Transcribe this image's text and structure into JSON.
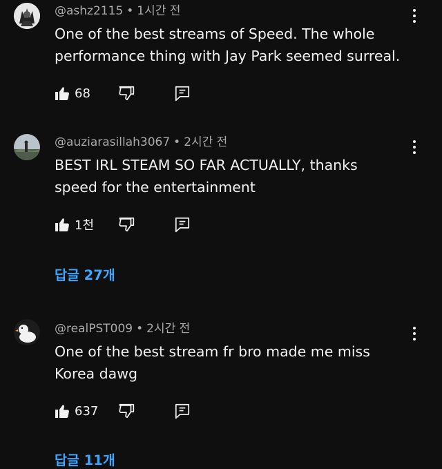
{
  "comments": [
    {
      "handle": "@ashz2115",
      "separator": "•",
      "time": "1시간 전",
      "lines": [
        "One of the best streams of Speed. The whole",
        "performance thing with Jay Park seemed surreal."
      ],
      "likes": "68",
      "replies": null
    },
    {
      "handle": "@auziarasillah3067",
      "separator": "•",
      "time": "2시간 전",
      "lines": [
        "BEST IRL STEAM SO FAR ACTUALLY, thanks",
        "speed for the entertainment"
      ],
      "likes": "1천",
      "replies": "답글 27개"
    },
    {
      "handle": "@realPST009",
      "separator": "•",
      "time": "2시간 전",
      "lines": [
        "One of the best stream fr bro made me miss",
        "Korea dawg"
      ],
      "likes": "637",
      "replies": "답글 11개"
    }
  ],
  "icons": {
    "like": "thumbs-up-icon",
    "dislike": "thumbs-down-icon",
    "reply": "reply-comment-icon",
    "more": "more-vertical-icon"
  },
  "colors": {
    "background": "#0f0f0f",
    "text": "#f1f1f1",
    "meta": "#aaaaaa",
    "link": "#3ea6ff"
  }
}
